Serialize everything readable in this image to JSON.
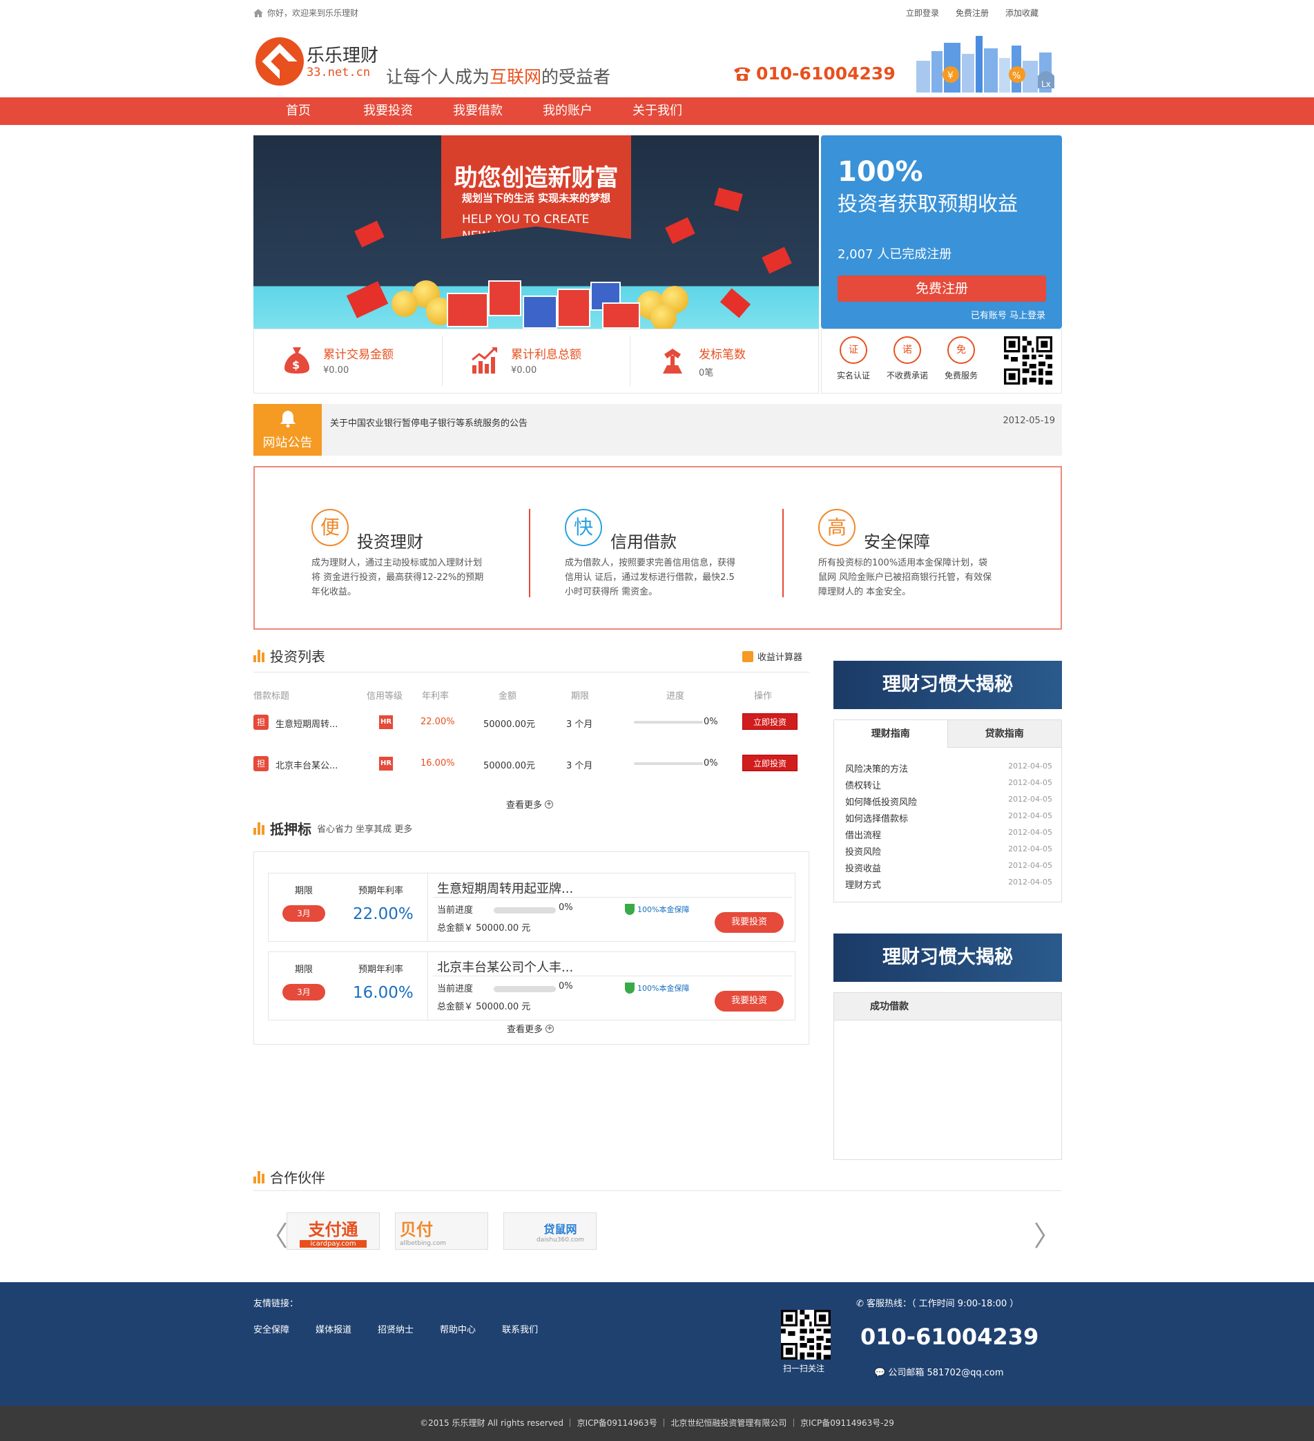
{
  "topbar": {
    "welcome": "你好，欢迎来到乐乐理财",
    "links": [
      "立即登录",
      "免费注册",
      "添加收藏"
    ]
  },
  "header": {
    "logo_name": "乐乐理财",
    "logo_url": "33.net.cn",
    "slogan_pre": "让每个人成为",
    "slogan_hl": "互联网",
    "slogan_post": "的受益者",
    "phone": "010-61004239"
  },
  "nav": [
    "首页",
    "我要投资",
    "我要借款",
    "我的账户",
    "关于我们"
  ],
  "banner": {
    "title": "助您创造新财富",
    "subtitle": "规划当下的生活 实现未来的梦想",
    "en1": "HELP YOU TO CREATE",
    "en2": "NEW WEALTH"
  },
  "promo": {
    "percent": "100%",
    "desc": "投资者获取预期收益",
    "registered": "2,007 人已完成注册",
    "register_btn": "免费注册",
    "login_link": "已有账号 马上登录"
  },
  "stats": [
    {
      "label": "累计交易金额",
      "value": "¥0.00"
    },
    {
      "label": "累计利息总额",
      "value": "¥0.00"
    },
    {
      "label": "发标笔数",
      "value": "0笔"
    }
  ],
  "trust": [
    {
      "glyph": "证",
      "label": "实名认证"
    },
    {
      "glyph": "诺",
      "label": "不收费承诺"
    },
    {
      "glyph": "免",
      "label": "免费服务"
    }
  ],
  "notice": {
    "tag": "网站公告",
    "text": "关于中国农业银行暂停电子银行等系统服务的公告",
    "date": "2012-05-19"
  },
  "features": [
    {
      "glyph": "便",
      "title": "投资理财",
      "desc": "成为理财人，通过主动投标或加入理财计划将 资金进行投资，最高获得12-22%的预期年化收益。"
    },
    {
      "glyph": "快",
      "title": "信用借款",
      "desc": "成为借款人，按照要求完善信用信息，获得信用认 证后，通过发标进行借款，最快2.5小时可获得所 需资金。"
    },
    {
      "glyph": "高",
      "title": "安全保障",
      "desc": "所有投资标的100%适用本金保障计划，袋鼠网 风险金账户已被招商银行托管，有效保障理财人的 本金安全。"
    }
  ],
  "invest": {
    "title": "投资列表",
    "calc": "收益计算器",
    "headers": [
      "借款标题",
      "信用等级",
      "年利率",
      "金额",
      "期限",
      "进度",
      "操作"
    ],
    "rows": [
      {
        "tag": "担",
        "name": "生意短期周转...",
        "grade": "HR",
        "rate": "22.00%",
        "amount": "50000.00元",
        "term": "3 个月",
        "progress": "0%",
        "btn": "立即投资"
      },
      {
        "tag": "担",
        "name": "北京丰台某公...",
        "grade": "HR",
        "rate": "16.00%",
        "amount": "50000.00元",
        "term": "3 个月",
        "progress": "0%",
        "btn": "立即投资"
      }
    ],
    "more": "查看更多"
  },
  "mortgage": {
    "title": "抵押标",
    "sub": "省心省力 坐享其成 更多",
    "cards": [
      {
        "l1": "期限",
        "l2": "预期年利率",
        "term": "3月",
        "rate": "22.00%",
        "name": "生意短期周转用起亚牌...",
        "prog_label": "当前进度",
        "progress": "0%",
        "total": "总金额￥ 50000.00 元",
        "guarantee": "100%本金保障",
        "btn": "我要投资"
      },
      {
        "l1": "期限",
        "l2": "预期年利率",
        "term": "3月",
        "rate": "16.00%",
        "name": "北京丰台某公司个人丰...",
        "prog_label": "当前进度",
        "progress": "0%",
        "total": "总金额￥ 50000.00 元",
        "guarantee": "100%本金保障",
        "btn": "我要投资"
      }
    ],
    "more": "查看更多"
  },
  "side1": {
    "head": "理财习惯大揭秘",
    "tabs": [
      "理财指南",
      "贷款指南"
    ],
    "items": [
      {
        "t": "风险决策的方法",
        "d": "2012-04-05"
      },
      {
        "t": "债权转让",
        "d": "2012-04-05"
      },
      {
        "t": "如何降低投资风险",
        "d": "2012-04-05"
      },
      {
        "t": "如何选择借款标",
        "d": "2012-04-05"
      },
      {
        "t": "借出流程",
        "d": "2012-04-05"
      },
      {
        "t": "投资风险",
        "d": "2012-04-05"
      },
      {
        "t": "投资收益",
        "d": "2012-04-05"
      },
      {
        "t": "理财方式",
        "d": "2012-04-05"
      }
    ]
  },
  "side2": {
    "head": "理财习惯大揭秘",
    "tab": "成功借款"
  },
  "partners": {
    "title": "合作伙伴",
    "logos": [
      {
        "name": "支付通",
        "sub": "icardpay.com"
      },
      {
        "name": "贝付",
        "sub": "allbetbing.com"
      },
      {
        "name": "贷鼠网",
        "sub": "daishu360.com"
      }
    ]
  },
  "footer": {
    "links_title": "友情链接：",
    "links": [
      "安全保障",
      "媒体报道",
      "招贤纳士",
      "帮助中心",
      "联系我们"
    ],
    "qr_label": "扫一扫关注",
    "hotline": "客服热线：（ 工作时间 9:00-18:00 ）",
    "tel": "010-61004239",
    "mail": "公司邮箱 581702@qq.com"
  },
  "copyright": "©2015 乐乐理财 All rights reserved ｜ 京ICP备09114963号 ｜ 北京世纪恒融投资管理有限公司 ｜ 京ICP备09114963号-29",
  "colors": {
    "brand": "#e54a3a",
    "orange": "#e8501e",
    "blue": "#3a92d8",
    "footer": "#1f4170"
  }
}
